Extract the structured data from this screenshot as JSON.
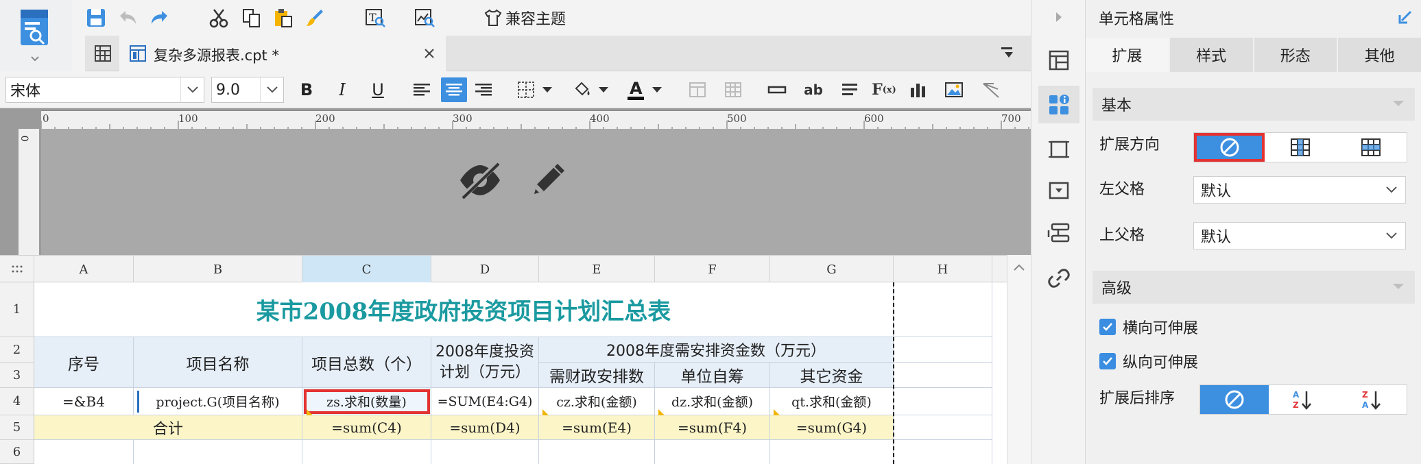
{
  "app": {
    "theme_label": "兼容主题"
  },
  "tab": {
    "file_name": "复杂多源报表.cpt *"
  },
  "format_bar": {
    "font_name": "宋体",
    "font_size": "9.0"
  },
  "ruler": {
    "ticks": [
      "0",
      "100",
      "200",
      "300",
      "400",
      "500",
      "600",
      "700"
    ],
    "vertical_tick": "0"
  },
  "sheet": {
    "columns": [
      "A",
      "B",
      "C",
      "D",
      "E",
      "F",
      "G",
      "H"
    ],
    "rows": [
      "1",
      "2",
      "3",
      "4",
      "5",
      "6"
    ],
    "title": "某市2008年度政府投资项目计划汇总表",
    "header": {
      "seq": "序号",
      "project_name": "项目名称",
      "project_count": "项目总数（个）",
      "plan_2008": "2008年度投资计划（万元）",
      "arrange_2008": "2008年度需安排资金数（万元）",
      "fiscal": "需财政安排数",
      "self_raised": "单位自筹",
      "other": "其它资金"
    },
    "row4": {
      "a": "=&B4",
      "b": "project.G(项目名称)",
      "c": "zs.求和(数量)",
      "d": "=SUM(E4:G4)",
      "e": "cz.求和(金额)",
      "f": "dz.求和(金额)",
      "g": "qt.求和(金额)"
    },
    "row5": {
      "label": "合计",
      "c": "=sum(C4)",
      "d": "=sum(D4)",
      "e": "=sum(E4)",
      "f": "=sum(F4)",
      "g": "=sum(G4)"
    },
    "selected_cell": "C4"
  },
  "panel": {
    "title": "单元格属性",
    "tabs": [
      "扩展",
      "样式",
      "形态",
      "其他"
    ],
    "active_tab": "扩展",
    "basic_section": "基本",
    "expand_direction_label": "扩展方向",
    "left_parent_label": "左父格",
    "left_parent_value": "默认",
    "top_parent_label": "上父格",
    "top_parent_value": "默认",
    "advanced_section": "高级",
    "h_expand_label": "横向可伸展",
    "v_expand_label": "纵向可伸展",
    "h_expand_checked": true,
    "v_expand_checked": true,
    "sort_label": "扩展后排序"
  },
  "colors": {
    "title_teal": "#1a9aa0",
    "accent_blue": "#3d8fe0",
    "highlight_red": "#e33333",
    "header_fill": "#e6eef8",
    "sum_fill": "#fbf5c8",
    "selected_col": "#cfe6f6"
  }
}
